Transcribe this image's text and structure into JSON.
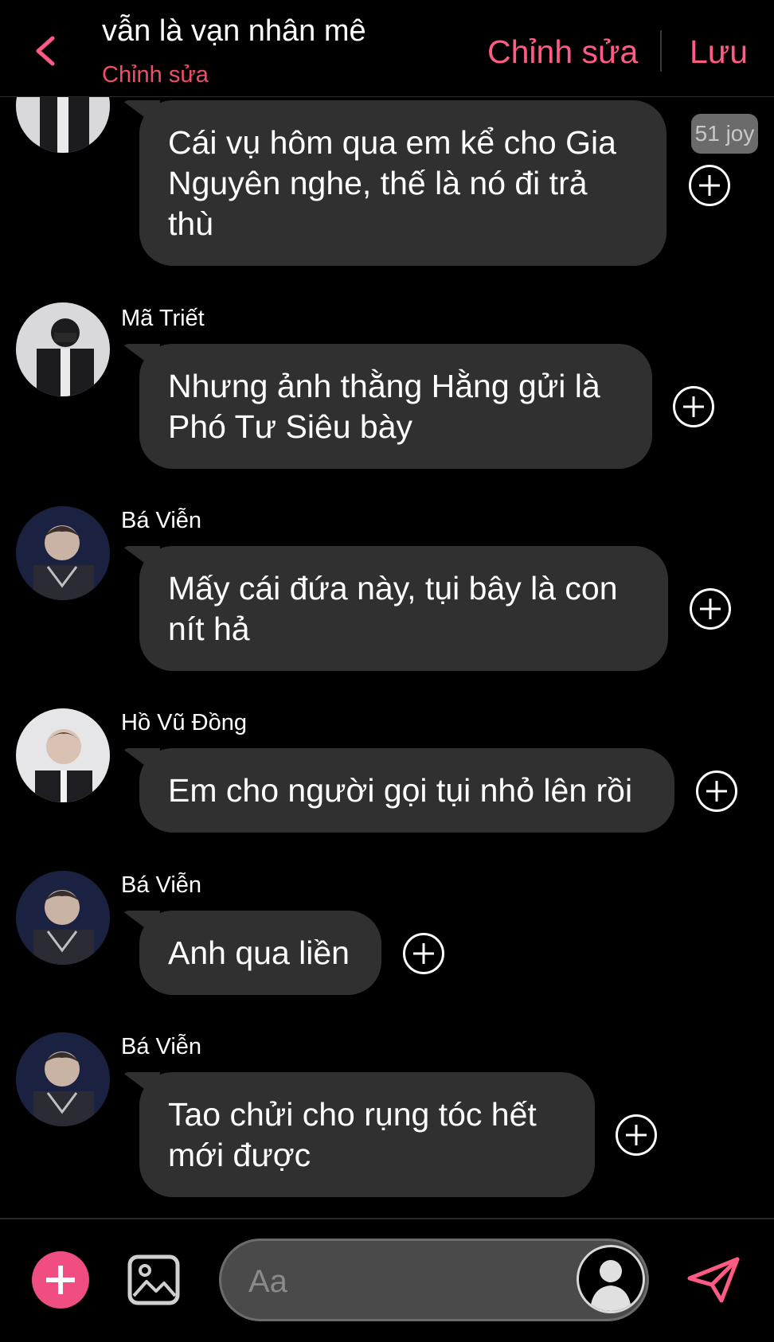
{
  "header": {
    "title": "vẫn là vạn nhân mê",
    "subtitle": "Chỉnh sửa",
    "edit_label": "Chỉnh sửa",
    "save_label": "Lưu"
  },
  "reaction_badge": "51 joy",
  "messages": [
    {
      "sender": "",
      "lines": [
        "Cái vụ hôm qua em kể cho Gia",
        "Nguyên nghe, thế là nó đi trả",
        "thù"
      ]
    },
    {
      "sender": "Mã Triết",
      "lines": [
        "Nhưng ảnh thằng Hằng gửi là",
        "Phó Tư Siêu bày"
      ]
    },
    {
      "sender": "Bá Viễn",
      "lines": [
        "Mấy cái đứa này, tụi bây là con",
        "nít hả"
      ]
    },
    {
      "sender": "Hồ Vũ Đồng",
      "lines": [
        "Em cho người gọi tụi nhỏ lên rồi"
      ]
    },
    {
      "sender": "Bá Viễn",
      "lines": [
        "Anh qua liền"
      ]
    },
    {
      "sender": "Bá Viễn",
      "lines": [
        "Tao chửi cho rụng tóc hết",
        "mới được"
      ]
    }
  ],
  "composer": {
    "placeholder": "Aa"
  },
  "icons": {
    "back": "chevron-left-icon",
    "add": "plus-icon",
    "image": "image-icon",
    "voice": "avatar-icon",
    "send": "send-icon",
    "react": "plus-circle-icon"
  },
  "colors": {
    "accent": "#ff5b84",
    "subtitle": "#ef4f64",
    "bubble": "#303030",
    "background": "#000000"
  }
}
